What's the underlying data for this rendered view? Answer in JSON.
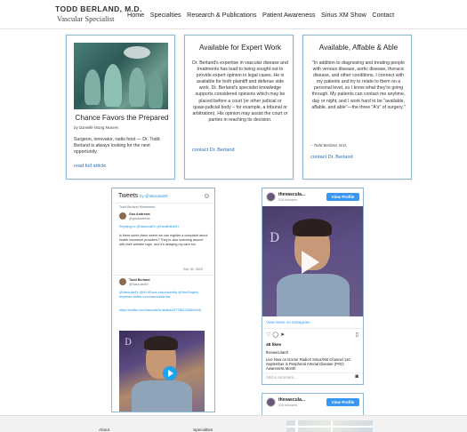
{
  "header": {
    "logo_name": "TODD BERLAND, M.D.",
    "logo_title": "Vascular Specialist",
    "nav": [
      "Home",
      "Specialties",
      "Research & Publications",
      "Patient Awareness",
      "Sirius XM Show",
      "Contact"
    ]
  },
  "cards": [
    {
      "title": "Chance Favors the Prepared",
      "byline": "by Danielle Wang Moores",
      "text": "Surgeon, innovator, radio host — Dr. Todd Berland is always looking for the next opportunity.",
      "link": "read full article"
    },
    {
      "title": "Available for Expert Work",
      "text": "Dr. Berland's expertise in vascular disease and treatments has lead to being sought out to provide expert opinion in legal cases. He is available for both plaintiff and defense side work. Dr. Berland's specialist knowledge supports considered opinions which may be placed before a court (or other judicial or quasi-judicial body – for example, a tribunal or arbitration). His opinion may assist the court or parties in reaching its decision.",
      "link": "contact Dr. Berland"
    },
    {
      "title": "Available, Affable & Able",
      "text": "\"In addition to diagnosing and treating people with venous disease, aortic disease, thoracic disease, and other conditions, I connect with my patients and try to relate to them on a personal level, so I know what they're going through. My patients can contact me anytime, day or night, and I work hard to be \"available, affable, and able\"—the three \"A's\" of surgery.\"",
      "attribution": "– Todd Berland, M.D.",
      "link": "contact Dr. Berland"
    }
  ],
  "tweets": {
    "header": "Tweets",
    "by": "by @VascularDr",
    "retweeted": "Todd Berland Retweeted",
    "tweet1": {
      "name": "Gus Andrews",
      "handle": "@gusandrews",
      "replying": "Replying to @VascularDr @HealthfirstNY",
      "text": "Is there some place where we can register a complaint about health insurance providers? They're also screwing around with their website login, and it's delaying my care too.",
      "date": "Sep 30, 2019"
    },
    "tweet2": {
      "name": "Todd Berland",
      "handle": "@VascularDr",
      "text": "@VascularDr @NYUDocs #nyuniversity @VesSurgery #nytimes twitter.com/vasculardr/sta",
      "link": "https://twitter.com/VascularDr/status/1177881206834448"
    },
    "video_logo": "D"
  },
  "instagram": {
    "user": "thevascula...",
    "followers": "328 followers",
    "view_profile": "View Profile",
    "view_more": "View More on Instagram",
    "likes": "48 likes",
    "caption_user": "thevasculardr",
    "caption": "Live Now on Doctor Radio!! Sirius/XM Channel 110. September is Peripheral Arterial Disease (PAD) Awareness Month",
    "add_comment": "Add a comment...",
    "photo_logo": "D"
  },
  "footer": {
    "about": "About",
    "specialties": "Specialties"
  },
  "colors": {
    "card_border": "#8fb7cf",
    "link": "#2a6db5",
    "instagram_button": "#3897f0",
    "twitter_blue": "#1b95e0"
  }
}
